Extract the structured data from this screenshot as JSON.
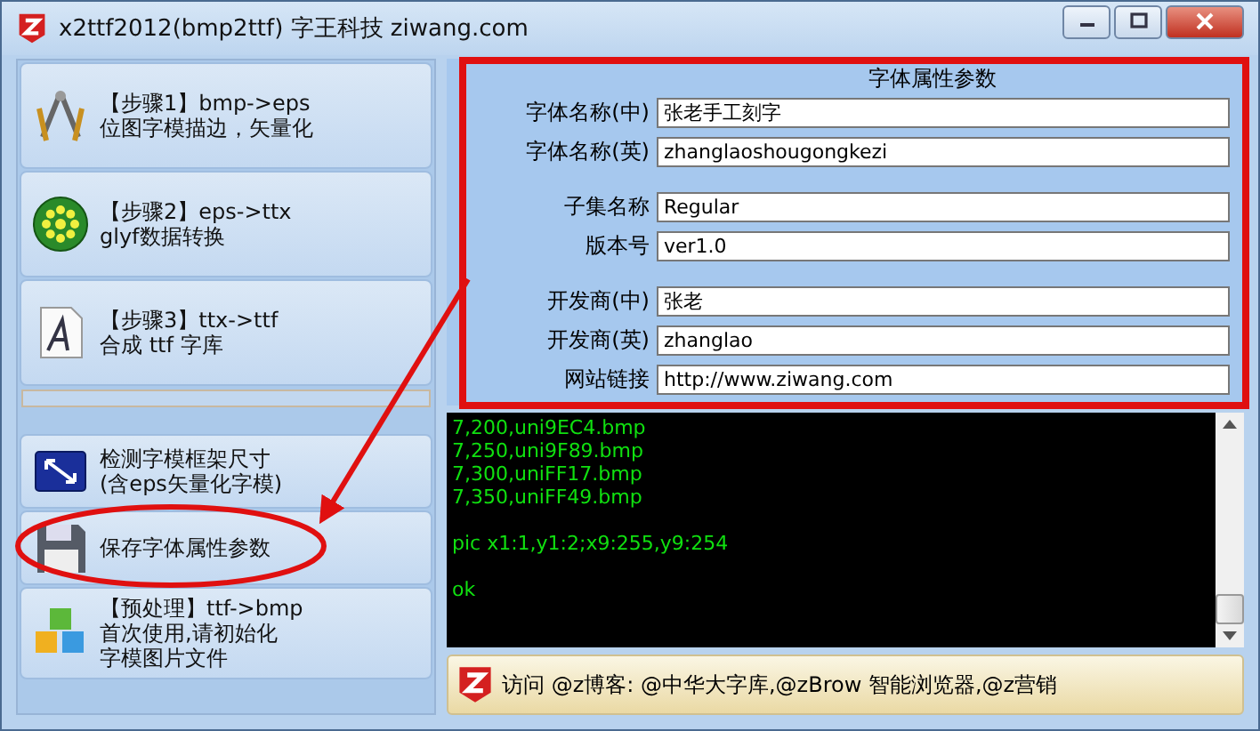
{
  "window": {
    "title": "x2ttf2012(bmp2ttf) 字王科技 ziwang.com"
  },
  "steps_top": [
    {
      "kind": "compass",
      "lines": [
        "【步骤1】bmp->eps",
        "位图字模描边，矢量化"
      ]
    },
    {
      "kind": "flower",
      "lines": [
        "【步骤2】eps->ttx",
        "glyf数据转换"
      ]
    },
    {
      "kind": "font",
      "lines": [
        "【步骤3】ttx->ttf",
        "合成 ttf 字库"
      ]
    }
  ],
  "steps_bottom": [
    {
      "kind": "resize",
      "lines": [
        "检测字模框架尺寸",
        "(含eps矢量化字模)"
      ]
    },
    {
      "kind": "disk",
      "lines": [
        "保存字体属性参数"
      ]
    },
    {
      "kind": "cubes",
      "lines": [
        "【预处理】ttf->bmp",
        "首次使用,请初始化",
        "字模图片文件"
      ]
    }
  ],
  "properties": {
    "title": "字体属性参数",
    "groups": [
      [
        {
          "label": "字体名称(中)",
          "value": "张老手工刻字"
        },
        {
          "label": "字体名称(英)",
          "value": "zhanglaoshougongkezi"
        }
      ],
      [
        {
          "label": "子集名称",
          "value": "Regular"
        },
        {
          "label": "版本号",
          "value": "ver1.0"
        }
      ],
      [
        {
          "label": "开发商(中)",
          "value": "张老"
        },
        {
          "label": "开发商(英)",
          "value": "zhanglao"
        },
        {
          "label": "网站链接",
          "value": "http://www.ziwang.com"
        }
      ]
    ]
  },
  "log": {
    "blocks": [
      [
        "7,200,uni9EC4.bmp",
        "7,250,uni9F89.bmp",
        "7,300,uniFF17.bmp",
        "7,350,uniFF49.bmp"
      ],
      [
        "pic x1:1,y1:2;x9:255,y9:254"
      ],
      [
        "ok"
      ]
    ]
  },
  "notice": {
    "text": "访问 @z博客: @中华大字库,@zBrow 智能浏览器,@z营销"
  },
  "annotations": [
    {
      "kind": "rectangle"
    },
    {
      "kind": "arrow"
    },
    {
      "kind": "ellipse"
    }
  ]
}
